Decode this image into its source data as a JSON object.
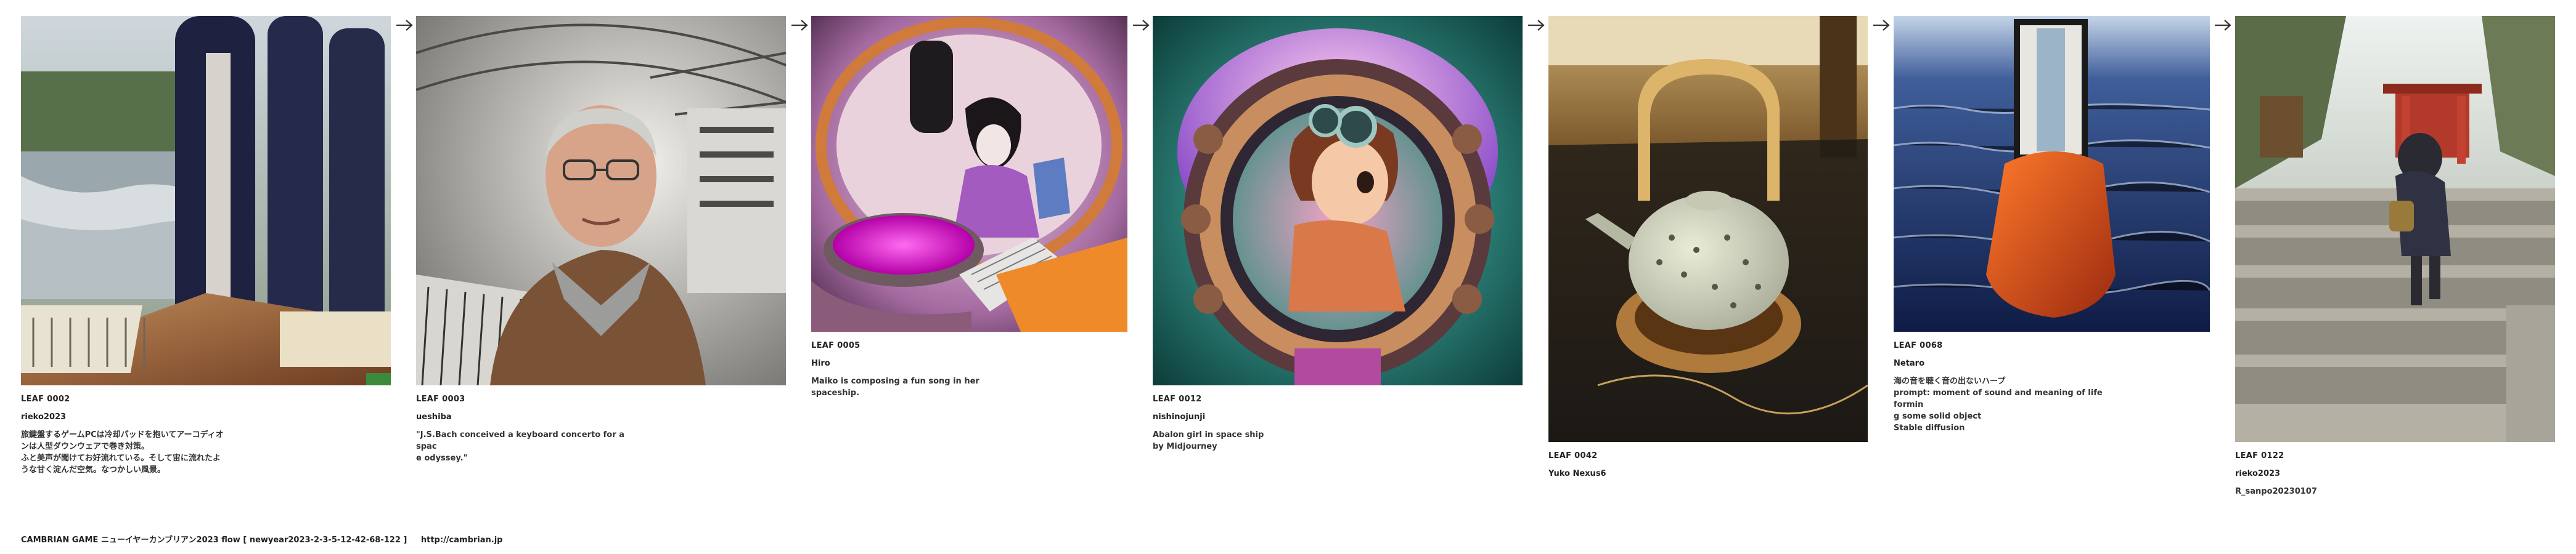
{
  "leaves": [
    {
      "id_label": "LEAF 0002",
      "author": "rieko2023",
      "caption": "旅鍵盤するゲームPCは冷却パッドを抱いてアーコディオ\nンは人型ダウンウェアで巻き対策。\nふと美声が聞けてお好流れている。そして宙に流れたよ\nうな甘く淀んだ空気。なつかしい風景。",
      "image_alt": "concert piano instrument with waterfall landscape"
    },
    {
      "id_label": "LEAF 0003",
      "author": "ueshiba",
      "caption": "\"J.S.Bach conceived a keyboard concerto for a spac\ne odyssey.\"",
      "image_alt": "older man in a space suit at a keyboard inside spaceship"
    },
    {
      "id_label": "LEAF 0005",
      "author": "Hiro",
      "caption": "Maiko is composing a fun song in her spaceship.",
      "image_alt": "maiko at a console inside a round spaceship"
    },
    {
      "id_label": "LEAF 0012",
      "author": "nishinojunji",
      "caption": "Abalon girl in space ship\nby Midjourney",
      "image_alt": "girl with goggles inside ornate spaceship porthole"
    },
    {
      "id_label": "LEAF 0042",
      "author": "Yuko Nexus6",
      "caption": "",
      "image_alt": "ceramic teapot on a wooden coaster"
    },
    {
      "id_label": "LEAF 0068",
      "author": "Netaro",
      "caption": "海の音を聴く音の出ないハープ\nprompt: moment of sound and meaning of life formin\ng some solid object\nStable diffusion",
      "image_alt": "orange object with frame standing in the sea"
    },
    {
      "id_label": "LEAF 0122",
      "author": "rieko2023",
      "caption": "R_sanpo20230107",
      "image_alt": "person walking up stone steps near a shrine"
    }
  ],
  "footer": {
    "title": "CAMBRIAN GAME  ニューイヤーカンブリアン2023  flow [ newyear2023-2-3-5-12-42-68-122 ]",
    "url": "http://cambrian.jp"
  },
  "icons": {
    "arrow": "arrow-right-icon"
  }
}
